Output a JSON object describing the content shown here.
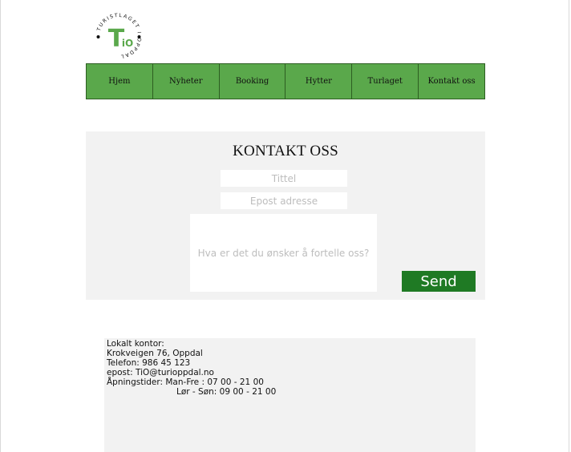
{
  "logo": {
    "ring_text": "TURISTLAGET I OPPDAL",
    "letter": "T",
    "suffix": "iO",
    "color": "#5aa84b",
    "icon": "turistlaget-logo-icon"
  },
  "nav": {
    "items": [
      {
        "label": "Hjem"
      },
      {
        "label": "Nyheter"
      },
      {
        "label": "Booking"
      },
      {
        "label": "Hytter"
      },
      {
        "label": "Turlaget"
      },
      {
        "label": "Kontakt oss"
      }
    ],
    "background": "#5aa84b"
  },
  "contact": {
    "title": "KONTAKT OSS",
    "title_placeholder": "Tittel",
    "email_placeholder": "Epost adresse",
    "message_placeholder": "Hva er det du ønsker å fortelle oss?",
    "send_label": "Send",
    "send_color": "#1f7a24"
  },
  "info": {
    "lines": [
      "Lokalt kontor:",
      "Krokveigen 76, Oppdal",
      "Telefon: 986 45 123",
      "epost: TiO@turioppdal.no",
      "Åpningstider: Man-Fre : 07 00 - 21 00",
      "Lør - Søn: 09 00 - 21 00"
    ]
  }
}
